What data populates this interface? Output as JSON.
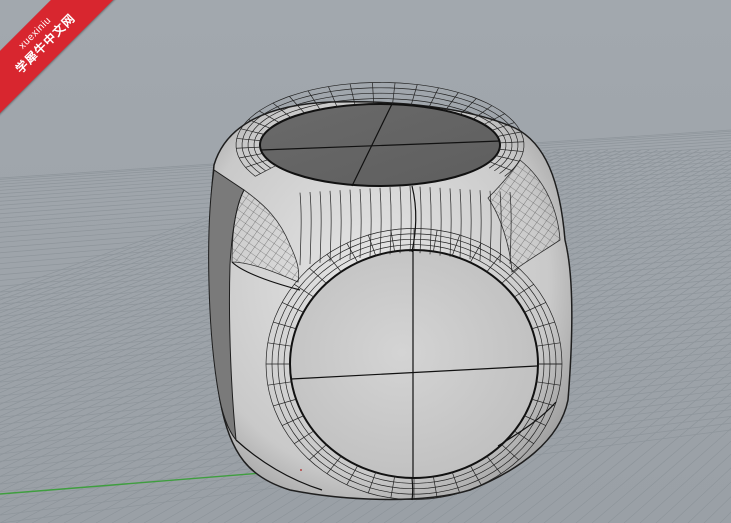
{
  "watermark": {
    "line1": "xuexiniu",
    "line2": "学犀牛中文网"
  },
  "viewport": {
    "background_color": "#9fa5ab",
    "grid_color": "#8e959b",
    "x_axis_color": "#b53a3a",
    "y_axis_color": "#3f9e3f",
    "object": "rounded-cube-surface"
  }
}
